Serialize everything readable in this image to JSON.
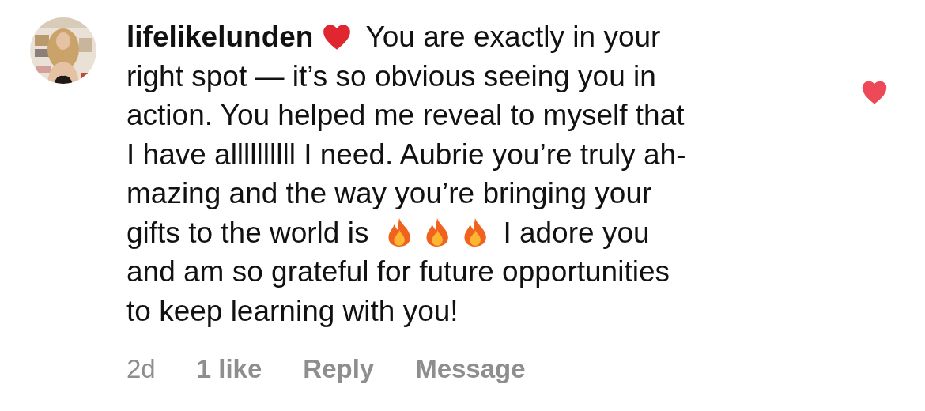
{
  "comment": {
    "liked": true,
    "lines": [
      {
        "segments": [
          {
            "kind": "username",
            "text": "lifelikelunden"
          },
          {
            "kind": "heart"
          },
          {
            "kind": "text",
            "text": "You are exactly in your"
          }
        ]
      },
      {
        "segments": [
          {
            "kind": "text",
            "text": "right spot — it’s so obvious seeing you in"
          }
        ]
      },
      {
        "segments": [
          {
            "kind": "text",
            "text": "action. You helped me reveal to myself that"
          }
        ]
      },
      {
        "segments": [
          {
            "kind": "text",
            "text": "I have allllllllll I need. Aubrie you’re truly ah-"
          }
        ]
      },
      {
        "segments": [
          {
            "kind": "text",
            "text": "mazing and the way you’re bringing your"
          }
        ]
      },
      {
        "segments": [
          {
            "kind": "text",
            "text": "gifts to the world is"
          },
          {
            "kind": "fire"
          },
          {
            "kind": "fire"
          },
          {
            "kind": "fire"
          },
          {
            "kind": "text",
            "text": "I adore you"
          }
        ]
      },
      {
        "segments": [
          {
            "kind": "text",
            "text": "and am so grateful for future opportunities"
          }
        ]
      },
      {
        "segments": [
          {
            "kind": "text",
            "text": "to keep learning with you!"
          }
        ]
      }
    ]
  },
  "footer": {
    "time": "2d",
    "likes": "1 like",
    "actions": [
      "Reply",
      "Message"
    ]
  }
}
